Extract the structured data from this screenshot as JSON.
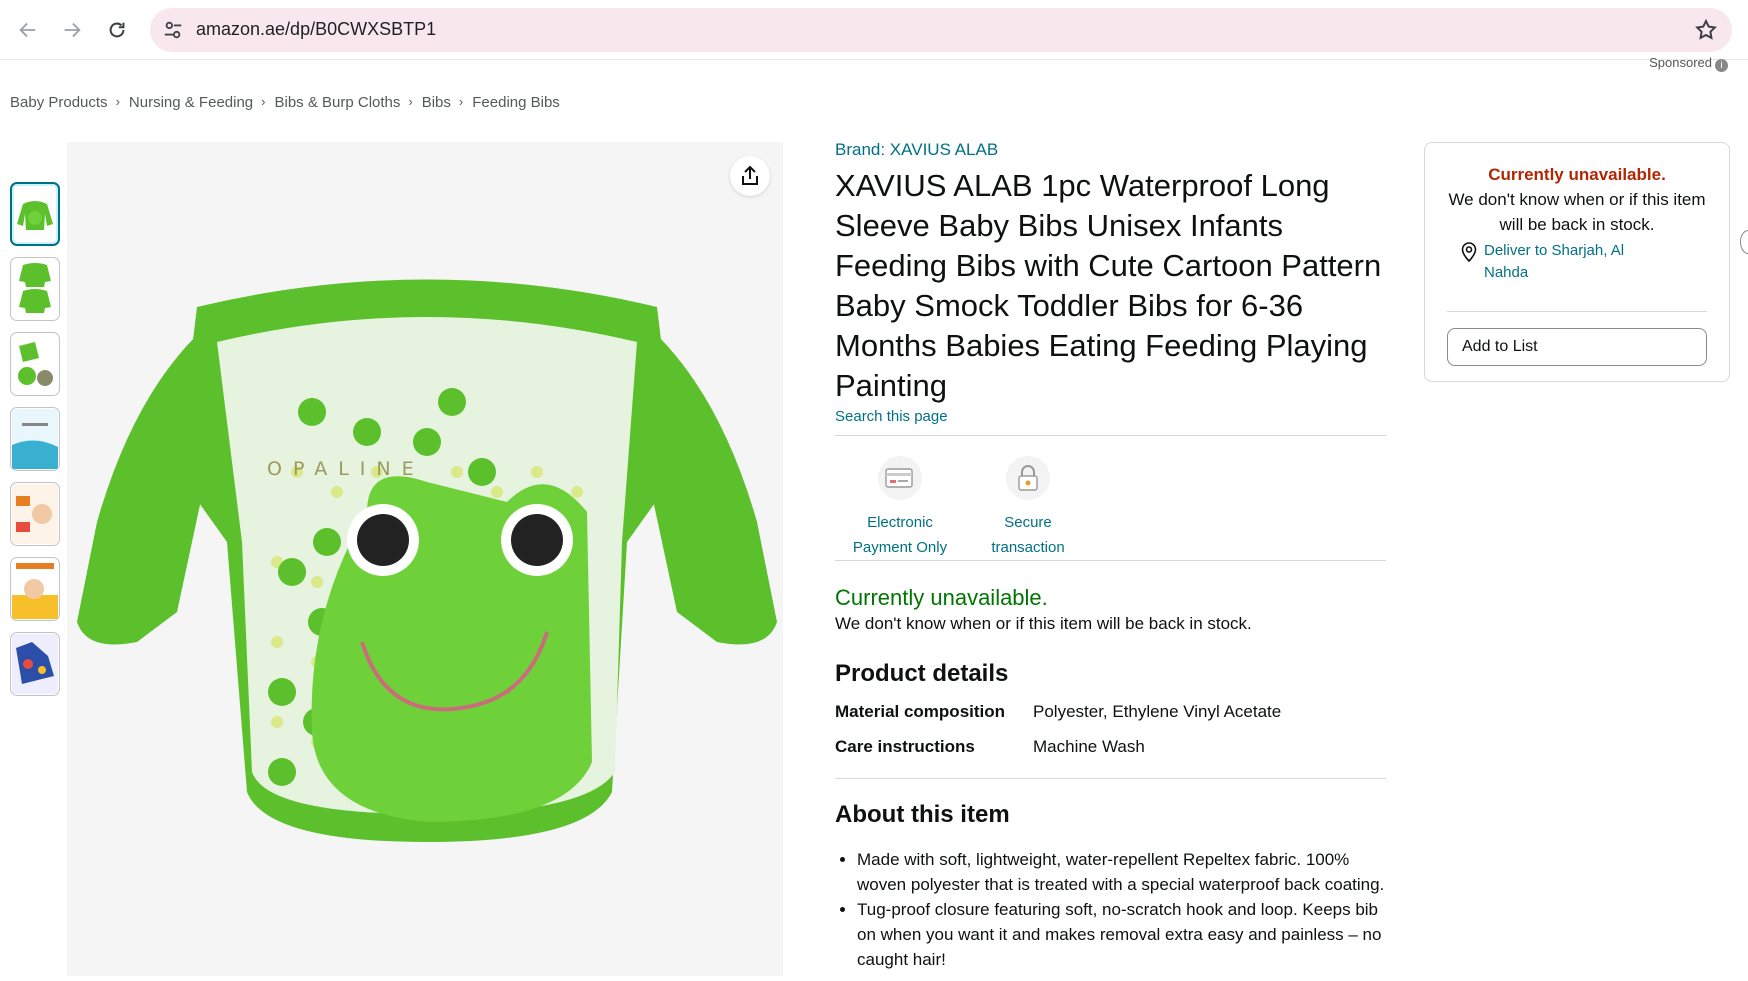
{
  "browser": {
    "url": "amazon.ae/dp/B0CWXSBTP1"
  },
  "sponsored_label": "Sponsored",
  "sponsored_info": "i",
  "breadcrumb": [
    "Baby Products",
    "Nursing & Feeding",
    "Bibs & Burp Cloths",
    "Bibs",
    "Feeding Bibs"
  ],
  "breadcrumb_separator": "›",
  "product": {
    "brand": "Brand: XAVIUS ALAB",
    "title": "XAVIUS ALAB 1pc Waterproof Long Sleeve Baby Bibs Unisex Infants Feeding Bibs with Cute Cartoon Pattern Baby Smock Toddler Bibs for 6-36 Months Babies Eating Feeding Playing Painting",
    "search_page": "Search this page",
    "image_print": "OPALINE",
    "badges": [
      {
        "label1": "Electronic",
        "label2": "Payment Only",
        "icon": "card-payment-icon"
      },
      {
        "label1": "Secure",
        "label2": "transaction",
        "icon": "lock-icon"
      }
    ],
    "availability": "Currently unavailable.",
    "availability_sub": "We don't know when or if this item will be back in stock.",
    "details_title": "Product details",
    "details": [
      {
        "key": "Material composition",
        "value": "Polyester, Ethylene Vinyl Acetate"
      },
      {
        "key": "Care instructions",
        "value": "Machine Wash"
      }
    ],
    "about_title": "About this item",
    "about_bullets": [
      "Made with soft, lightweight, water-repellent Repeltex fabric. 100% woven polyester that is treated with a special waterproof back coating.",
      "Tug-proof closure featuring soft, no-scratch hook and loop. Keeps bib on when you want it and makes removal extra easy and painless – no caught hair!"
    ]
  },
  "buybox": {
    "unavailable": "Currently unavailable.",
    "sub": "We don't know when or if this item will be back in stock.",
    "deliver": "Deliver to Sharjah, Al Nahda",
    "add_to_list": "Add to List"
  },
  "colors": {
    "link": "#007185",
    "available_green": "#007600",
    "unavailable_red": "#b12704",
    "bib_green": "#5cc02c"
  }
}
